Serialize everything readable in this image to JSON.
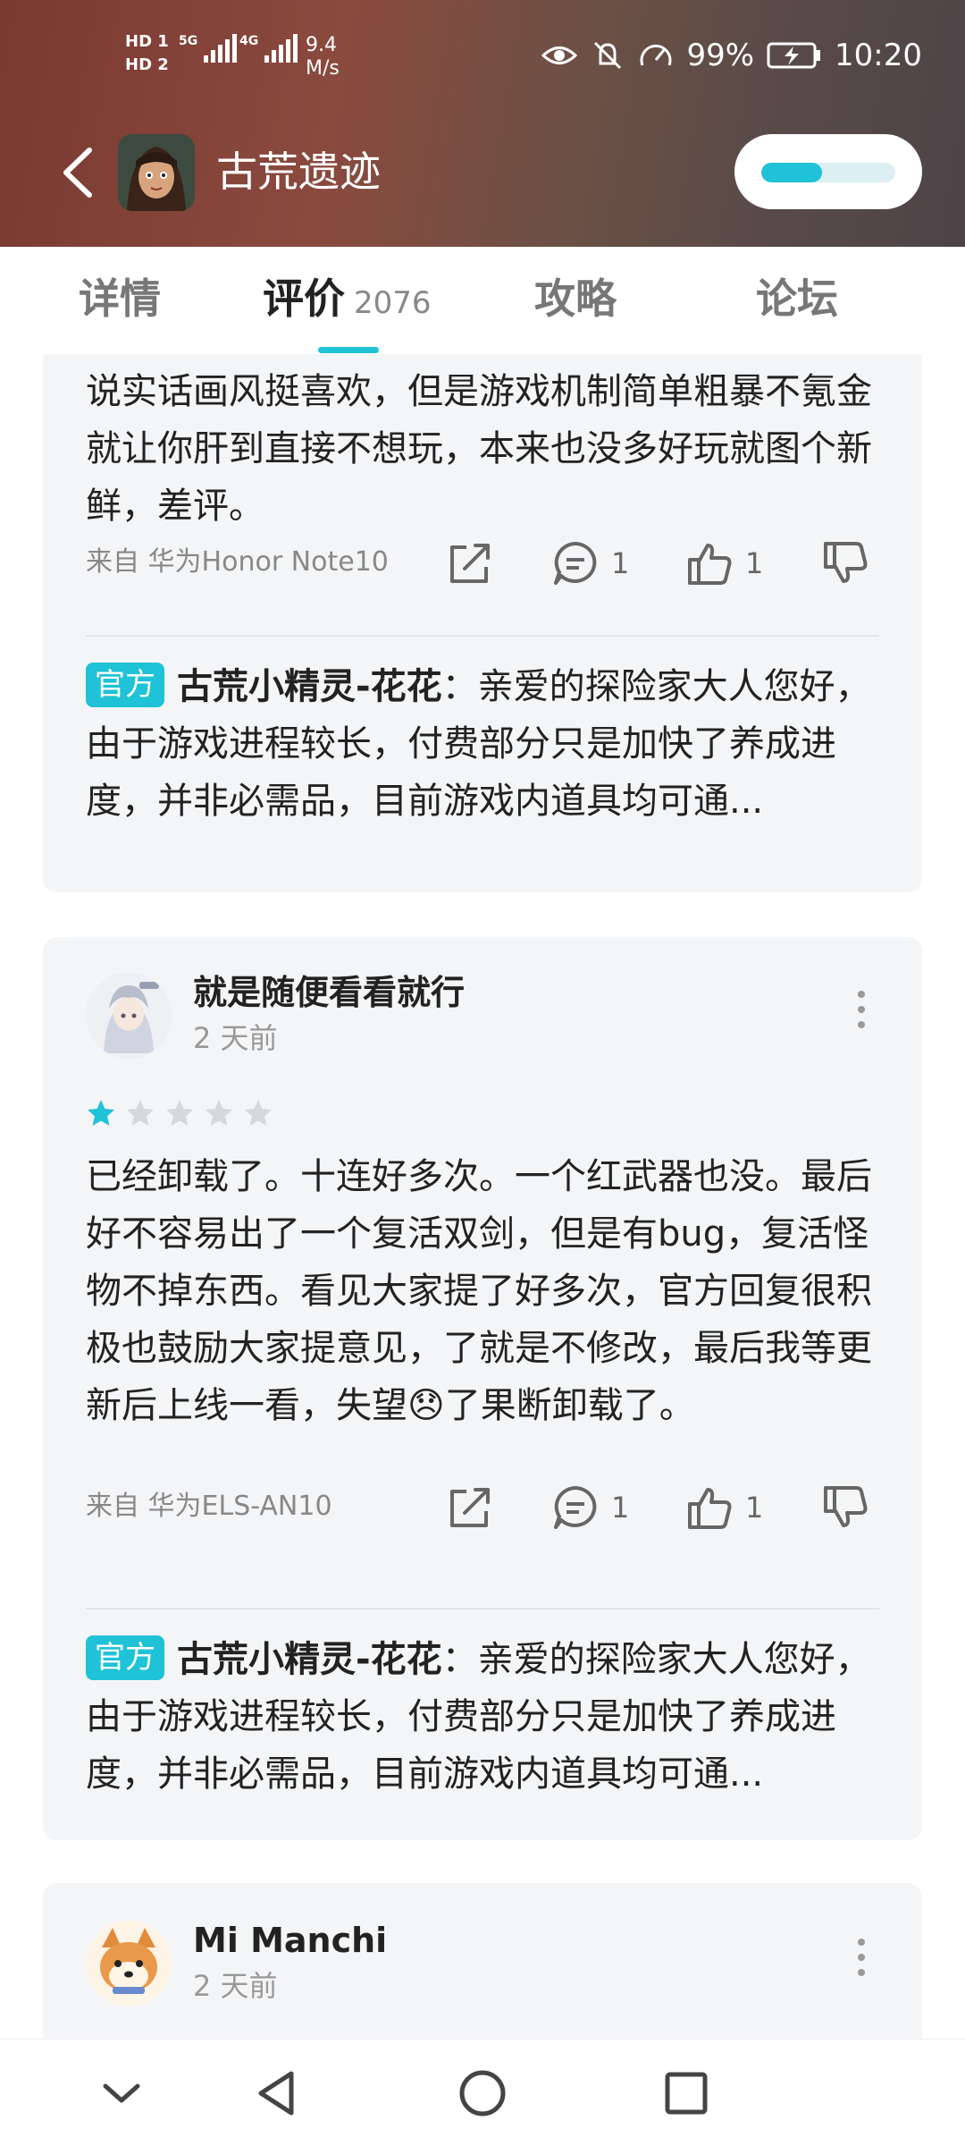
{
  "status_bar": {
    "hd_top": "HD 1",
    "hd_bottom": "HD 2",
    "sig1_label": "5G",
    "sig2_label": "4G",
    "speed_value": "9.4",
    "speed_unit": "M/s",
    "battery": "99%",
    "time": "10:20"
  },
  "header": {
    "game_title": "古荒遗迹",
    "progress_fraction": 0.45
  },
  "tabs": [
    {
      "label": "详情"
    },
    {
      "label": "评价",
      "count": "2076"
    },
    {
      "label": "攻略"
    },
    {
      "label": "论坛"
    }
  ],
  "reviews": [
    {
      "text": "说实话画风挺喜欢，但是游戏机制简单粗暴不氪金就让你肝到直接不想玩，本来也没多好玩就图个新鲜，差评。",
      "device": "来自 华为Honor Note10",
      "comments": "1",
      "likes": "1",
      "official_badge": "官方",
      "official_name": "古荒小精灵-花花",
      "official_reply": "：亲爱的探险家大人您好，由于游戏进程较长，付费部分只是加快了养成进度，并非必需品，目前游戏内道具均可通..."
    },
    {
      "user": "就是随便看看就行",
      "time": "2 天前",
      "stars": 1,
      "text_1": "已经卸载了。十连好多次。一个红武器也没。最后好不容易出了一个复活双剑，但是有bug，复活怪物不掉东西。看见大家提了好多次，官方回复很积极也鼓励大家提意见，了就是不修改，最后我等更新后上线一看，失望",
      "emoji": "😞",
      "text_2": "了果断卸载了。",
      "device": "来自 华为ELS-AN10",
      "comments": "1",
      "likes": "1",
      "official_badge": "官方",
      "official_name": "古荒小精灵-花花",
      "official_reply": "：亲爱的探险家大人您好，由于游戏进程较长，付费部分只是加快了养成进度，并非必需品，目前游戏内道具均可通..."
    },
    {
      "user": "Mi Manchi",
      "time": "2 天前"
    }
  ],
  "colors": {
    "accent": "#1fc2d7",
    "card_bg": "#f4f5f7",
    "star_empty": "#d6d8dc"
  }
}
